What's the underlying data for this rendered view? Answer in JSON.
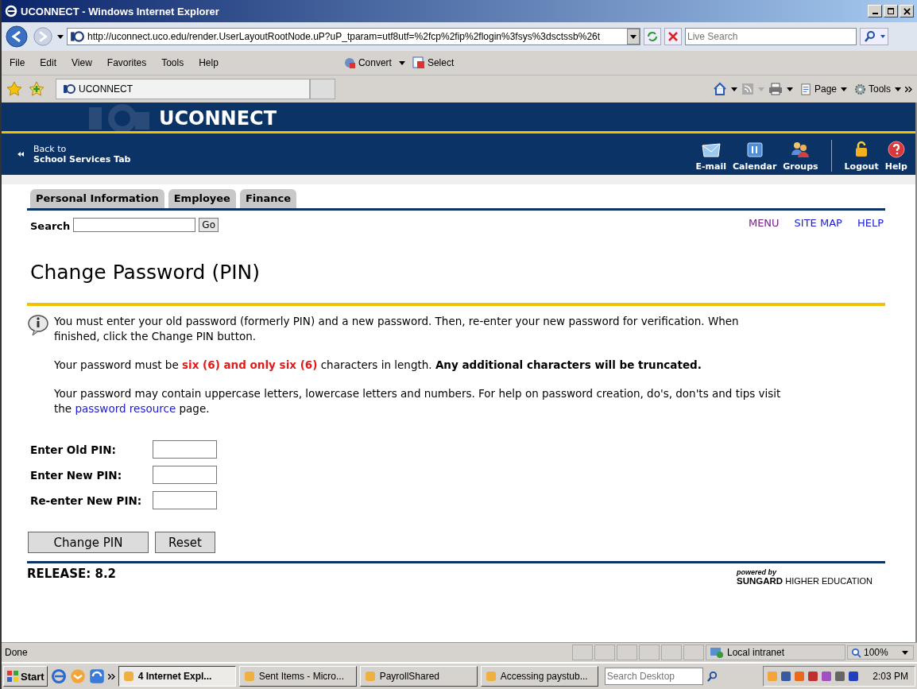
{
  "window": {
    "title": "UCONNECT - Windows Internet Explorer"
  },
  "address_bar": {
    "url": "http://uconnect.uco.edu/render.UserLayoutRootNode.uP?uP_tparam=utf8utf=%2fcp%2fip%2flogin%3fsys%3dsctssb%26t",
    "search_placeholder": "Live Search"
  },
  "menu_bar": [
    "File",
    "Edit",
    "View",
    "Favorites",
    "Tools",
    "Help"
  ],
  "toolbar_buttons": [
    "Convert",
    "Select"
  ],
  "browser_tab": {
    "title": "UCONNECT"
  },
  "command_bar": [
    "Page",
    "Tools"
  ],
  "banner": {
    "title": "UCONNECT",
    "back_line_1": "Back to",
    "back_line_2": "School Services Tab",
    "nav_items": [
      {
        "label": "E-mail",
        "kind": "mail"
      },
      {
        "label": "Calendar",
        "kind": "calendar"
      },
      {
        "label": "Groups",
        "kind": "groups"
      },
      {
        "label": "Logout",
        "kind": "logout"
      },
      {
        "label": "Help",
        "kind": "help"
      }
    ]
  },
  "tabs": [
    {
      "label": "Personal Information",
      "selected": false
    },
    {
      "label": "Employee",
      "selected": false
    },
    {
      "label": "Finance",
      "selected": false
    }
  ],
  "search": {
    "label": "Search",
    "button": "Go"
  },
  "top_links": [
    {
      "label": "MENU",
      "visited": true
    },
    {
      "label": "SITE MAP",
      "visited": false
    },
    {
      "label": "HELP",
      "visited": false
    }
  ],
  "page_title": "Change Password (PIN)",
  "info_paragraphs": [
    [
      {
        "kind": "plain",
        "text": "You must enter your old password (formerly PIN) and a new password. Then, re-enter your new password for verification. When finished, click the Change PIN button."
      }
    ],
    [
      {
        "kind": "plain",
        "text": "Your password must be "
      },
      {
        "kind": "alert",
        "text": "six (6) and only six (6)"
      },
      {
        "kind": "plain",
        "text": " characters in length. "
      },
      {
        "kind": "bold",
        "text": "Any additional characters will be truncated."
      }
    ],
    [
      {
        "kind": "plain",
        "text": "Your password may contain uppercase letters, lowercase letters and numbers. For help on password creation, do's, don'ts and tips visit the "
      },
      {
        "kind": "link",
        "text": "password resource"
      },
      {
        "kind": "plain",
        "text": " page."
      }
    ]
  ],
  "form_fields": [
    {
      "label": "Enter Old PIN:"
    },
    {
      "label": "Enter New PIN:"
    },
    {
      "label": "Re-enter New PIN:"
    }
  ],
  "buttons": [
    "Change PIN",
    "Reset"
  ],
  "release": "RELEASE: 8.2",
  "powered_by": {
    "line_1": "powered by",
    "brand": "SUNGARD",
    "line_2": "HIGHER EDUCATION"
  },
  "status_bar": {
    "text": "Done",
    "zone": "Local intranet",
    "zoom": "100%"
  },
  "taskbar": {
    "start": "Start",
    "tasks": [
      {
        "label": "4 Internet Expl...",
        "selected": true
      },
      {
        "label": "Sent Items - Micro...",
        "selected": false
      },
      {
        "label": "PayrollShared",
        "selected": false
      },
      {
        "label": "Accessing paystub...",
        "selected": false
      }
    ],
    "search_placeholder": "Search Desktop",
    "clock": "2:03 PM"
  }
}
